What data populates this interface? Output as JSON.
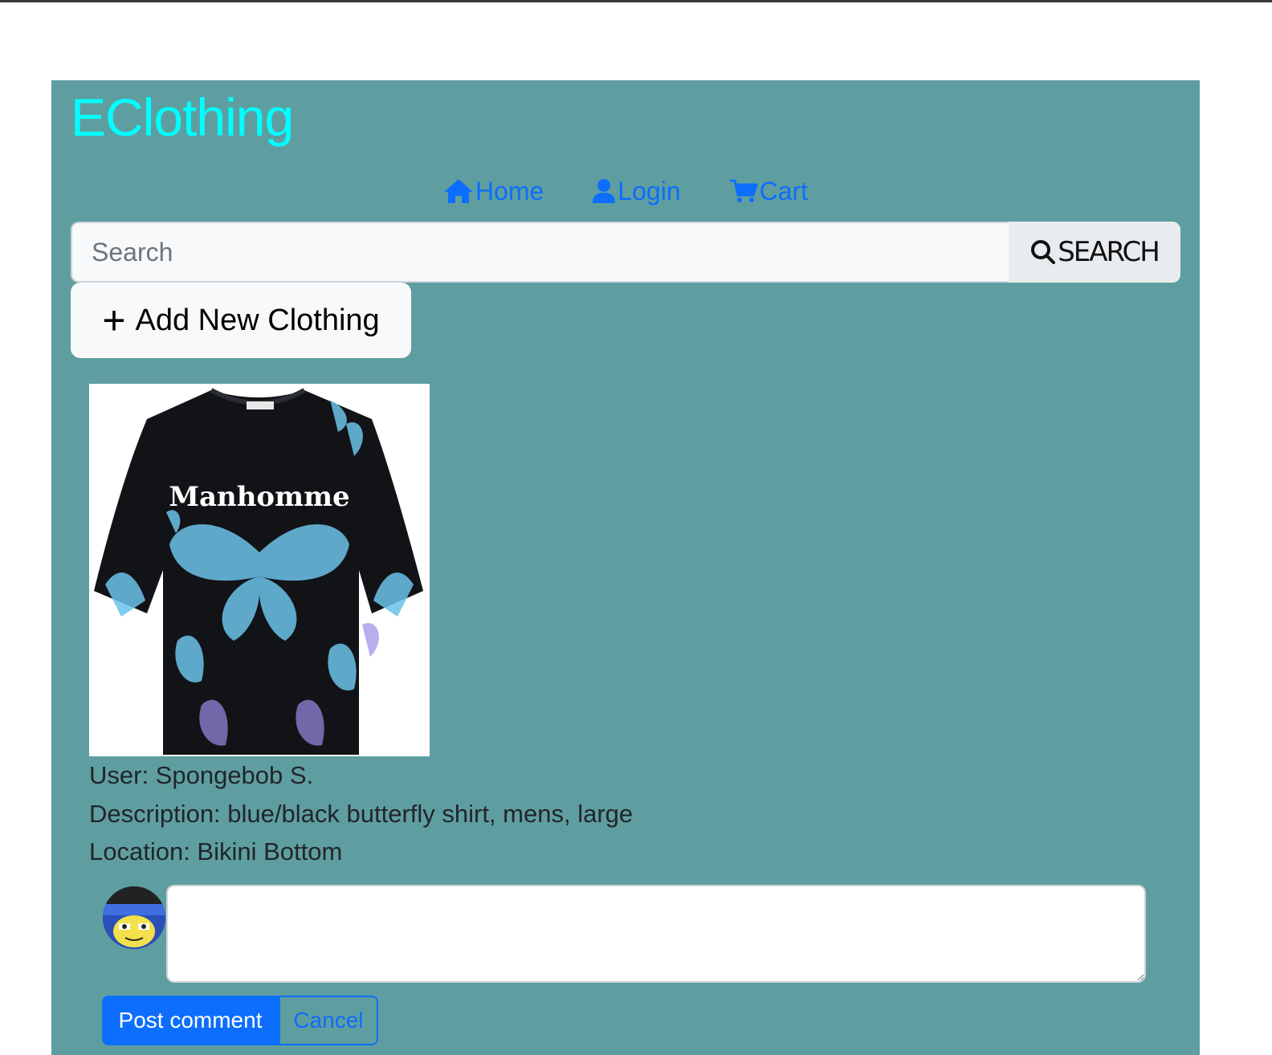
{
  "brand": "EClothing",
  "nav": {
    "home": "Home",
    "login": "Login",
    "cart": "Cart"
  },
  "search": {
    "placeholder": "Search",
    "value": "",
    "button_label": "SEARCH"
  },
  "add_button_label": "Add New Clothing",
  "item": {
    "user_line": "User: Spongebob S.",
    "description_line": "Description: blue/black butterfly shirt, mens, large",
    "location_line": "Location: Bikini Bottom",
    "shirt_print": "Manhomme"
  },
  "comment": {
    "value": "",
    "post_label": "Post comment",
    "cancel_label": "Cancel"
  },
  "colors": {
    "panel": "#5f9ea0",
    "brand": "#00ffff",
    "link": "#0d6efd",
    "primary": "#0d6efd"
  },
  "icons": {
    "home": "home-icon",
    "login": "user-icon",
    "cart": "cart-icon",
    "search": "search-icon",
    "add": "plus-icon"
  }
}
